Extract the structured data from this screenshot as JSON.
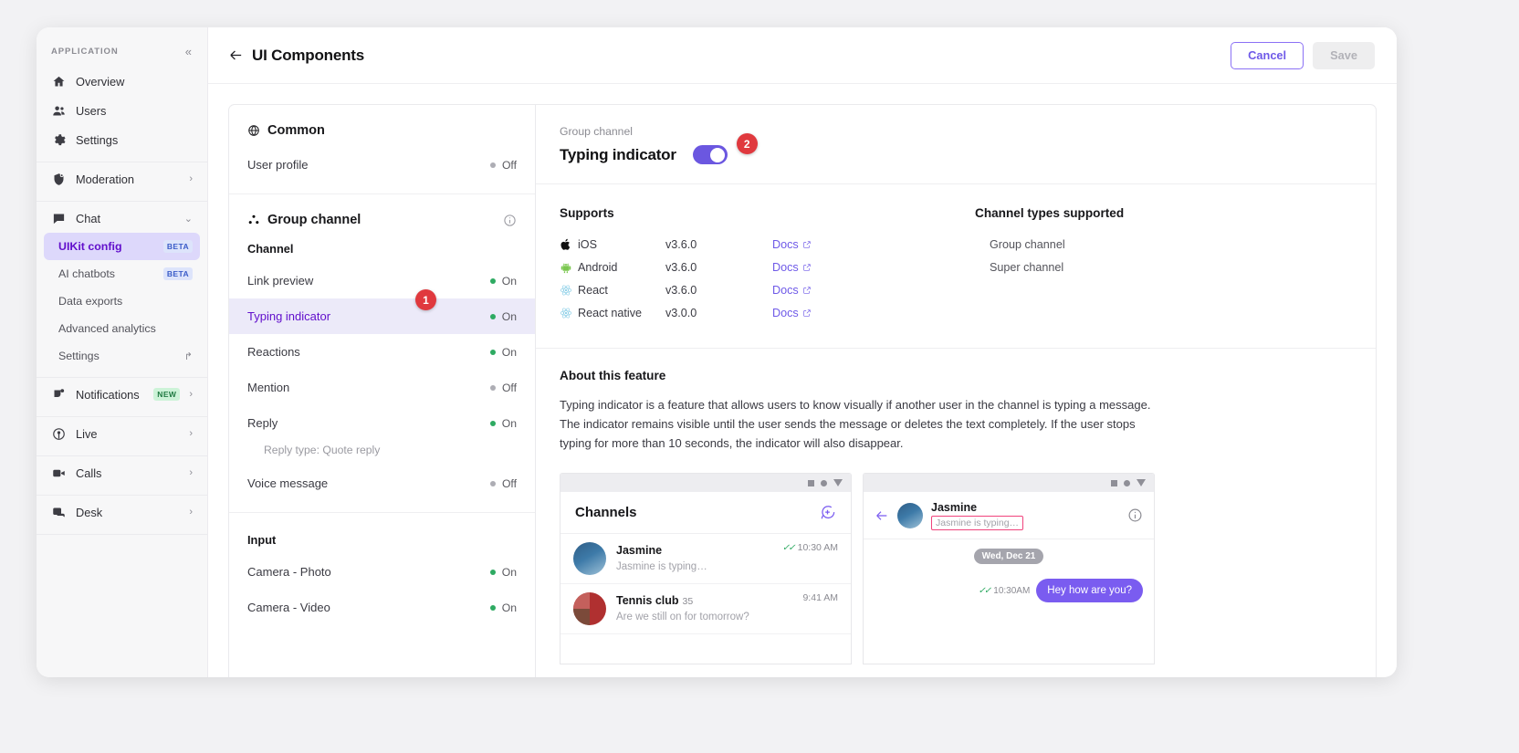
{
  "sidebar": {
    "app_label": "APPLICATION",
    "collapse_icon": "chevron-double-left-icon",
    "primary": [
      {
        "label": "Overview",
        "icon": "home-icon"
      },
      {
        "label": "Users",
        "icon": "users-icon"
      },
      {
        "label": "Settings",
        "icon": "gear-icon"
      }
    ],
    "moderation": {
      "label": "Moderation",
      "icon": "shield-icon",
      "chevron": "›"
    },
    "chat": {
      "label": "Chat",
      "icon": "chat-icon",
      "chevron": "⌄"
    },
    "chat_children": [
      {
        "label": "UIKit config",
        "badge": "BETA",
        "badge_type": "beta",
        "active": true
      },
      {
        "label": "AI chatbots",
        "badge": "BETA",
        "badge_type": "beta",
        "active": false
      },
      {
        "label": "Data exports",
        "badge": "",
        "badge_type": "",
        "active": false
      },
      {
        "label": "Advanced analytics",
        "badge": "",
        "badge_type": "",
        "active": false
      },
      {
        "label": "Settings",
        "badge": "",
        "badge_type": "",
        "active": false,
        "external": "↱"
      }
    ],
    "groups": [
      {
        "label": "Notifications",
        "icon": "bell-icon",
        "badge": "NEW",
        "badge_type": "new",
        "chevron": "›"
      },
      {
        "label": "Live",
        "icon": "broadcast-icon",
        "badge": "",
        "badge_type": "",
        "chevron": "›"
      },
      {
        "label": "Calls",
        "icon": "video-icon",
        "badge": "",
        "badge_type": "",
        "chevron": "›"
      },
      {
        "label": "Desk",
        "icon": "desk-icon",
        "badge": "",
        "badge_type": "",
        "chevron": "›"
      }
    ]
  },
  "topbar": {
    "back_icon": "arrow-left-icon",
    "title": "UI Components",
    "cancel_label": "Cancel",
    "save_label": "Save"
  },
  "list_panel": {
    "common": {
      "title": "Common",
      "icon": "globe-icon",
      "rows": [
        {
          "label": "User profile",
          "state": "Off",
          "on": false
        }
      ]
    },
    "group_channel": {
      "title": "Group channel",
      "icon": "group-icon",
      "info_icon": "info-icon",
      "channel_header": "Channel",
      "channel_rows": [
        {
          "label": "Link preview",
          "state": "On",
          "on": true,
          "active": false
        },
        {
          "label": "Typing indicator",
          "state": "On",
          "on": true,
          "active": true,
          "step": "1"
        },
        {
          "label": "Reactions",
          "state": "On",
          "on": true,
          "active": false
        },
        {
          "label": "Mention",
          "state": "Off",
          "on": false,
          "active": false
        },
        {
          "label": "Reply",
          "state": "On",
          "on": true,
          "active": false
        }
      ],
      "reply_note": "Reply type: Quote reply",
      "voice": {
        "label": "Voice message",
        "state": "Off",
        "on": false
      },
      "input_header": "Input",
      "input_rows": [
        {
          "label": "Camera - Photo",
          "state": "On",
          "on": true
        },
        {
          "label": "Camera - Video",
          "state": "On",
          "on": true
        }
      ]
    }
  },
  "detail": {
    "breadcrumb": "Group channel",
    "title": "Typing indicator",
    "toggle_on": true,
    "toggle_step": "2",
    "supports_title": "Supports",
    "supports": [
      {
        "platform": "iOS",
        "icon": "apple-icon",
        "version": "v3.6.0",
        "docs": "Docs",
        "docs_icon": "external-link-icon"
      },
      {
        "platform": "Android",
        "icon": "android-icon",
        "version": "v3.6.0",
        "docs": "Docs",
        "docs_icon": "external-link-icon"
      },
      {
        "platform": "React",
        "icon": "react-icon",
        "version": "v3.6.0",
        "docs": "Docs",
        "docs_icon": "external-link-icon"
      },
      {
        "platform": "React native",
        "icon": "react-icon",
        "version": "v3.0.0",
        "docs": "Docs",
        "docs_icon": "external-link-icon"
      }
    ],
    "types_title": "Channel types supported",
    "types": [
      "Group channel",
      "Super channel"
    ],
    "about_title": "About this feature",
    "about_text": "Typing indicator is a feature that allows users to know visually if another user in the channel is typing a message. The indicator remains visible until the user sends the message or deletes the text completely. If the user stops typing for more than 10 seconds, the indicator will also disappear."
  },
  "previews": {
    "channels": {
      "header": "Channels",
      "new_channel_icon": "new-chat-icon",
      "items": [
        {
          "name": "Jasmine",
          "count": "",
          "preview": "Jasmine is typing…",
          "time": "10:30 AM",
          "read": true
        },
        {
          "name": "Tennis club",
          "count": "35",
          "preview": "Are we still on for tomorrow?",
          "time": "9:41 AM",
          "read": false
        }
      ]
    },
    "chat": {
      "back_icon": "arrow-left-icon",
      "name": "Jasmine",
      "typing_text": "Jasmine is typing…",
      "info_icon": "info-circle-icon",
      "date_chip": "Wed, Dec 21",
      "message_time": "10:30AM",
      "message_text": "Hey how are you?"
    }
  },
  "colors": {
    "accent": "#6210cc",
    "purple": "#6f5ae8",
    "toggle_on": "#6b57e0",
    "step_badge": "#e0393e",
    "status_on": "#2eaa62",
    "status_off": "#adadb4",
    "highlight_row": "#eceaf9",
    "typing_outline": "#f0437c"
  }
}
